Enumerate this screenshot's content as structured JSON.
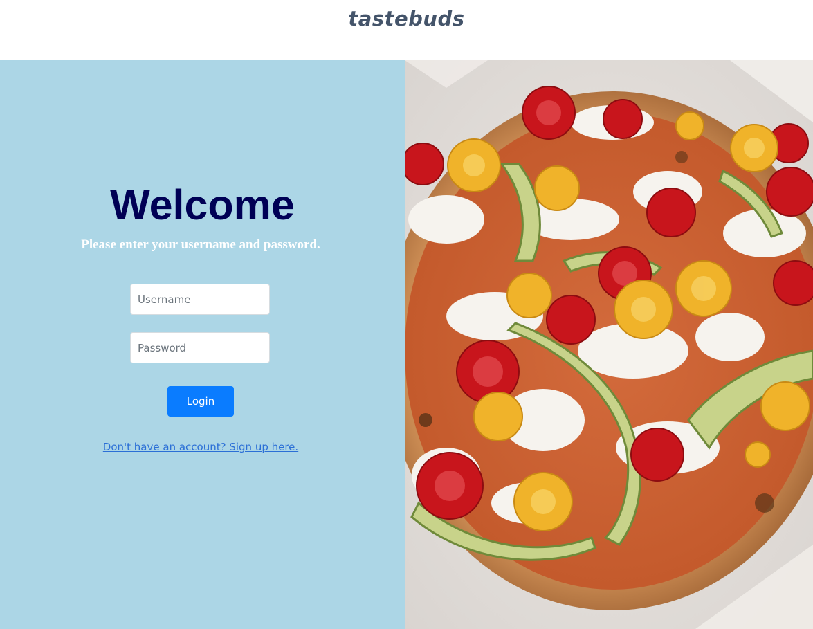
{
  "header": {
    "logo_text": "tastebuds"
  },
  "login": {
    "title": "Welcome",
    "subtitle": "Please enter your username and password.",
    "username_placeholder": "Username",
    "password_placeholder": "Password",
    "login_label": "Login",
    "signup_link": "Don't have an account? Sign up here."
  },
  "colors": {
    "panel_bg": "#acd6e6",
    "title": "#000055",
    "button": "#0a7cff",
    "link": "#2b6fd6",
    "logo": "#44546a"
  },
  "image": {
    "subject": "pizza with cherry tomatoes, zucchini and burrata"
  }
}
